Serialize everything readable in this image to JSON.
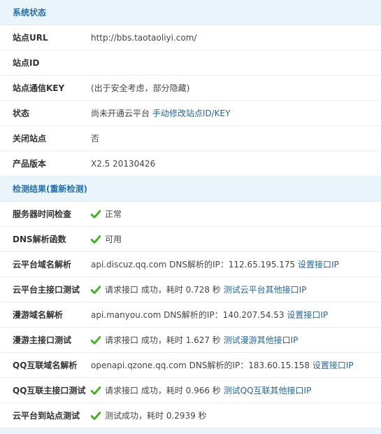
{
  "system_status": {
    "title": "系统状态",
    "rows": [
      {
        "label": "站点URL",
        "value": "http://bbs.taotaoliyi.com/"
      },
      {
        "label": "站点ID",
        "value": ""
      },
      {
        "label": "站点通信KEY",
        "value": "(出于安全考虑，部分隐藏)"
      },
      {
        "label": "状态",
        "value": "尚未开通云平台",
        "link": "手动修改站点ID/KEY"
      },
      {
        "label": "关闭站点",
        "value": "否"
      },
      {
        "label": "产品版本",
        "value": "X2.5 20130426"
      }
    ]
  },
  "check_results": {
    "title_prefix": "检测结果(",
    "recheck_link": "重新检测",
    "title_suffix": ")",
    "rows": [
      {
        "label": "服务器时间检查",
        "check": true,
        "value": "正常",
        "link": ""
      },
      {
        "label": "DNS解析函数",
        "check": true,
        "value": "可用",
        "link": ""
      },
      {
        "label": "云平台域名解析",
        "check": false,
        "value": "api.discuz.qq.com DNS解析的IP：112.65.195.175",
        "link": "设置接口IP"
      },
      {
        "label": "云平台主接口测试",
        "check": true,
        "value": "请求接口 成功，耗时 0.728 秒",
        "link": "测试云平台其他接口IP"
      },
      {
        "label": "漫游域名解析",
        "check": false,
        "value": "api.manyou.com DNS解析的IP：140.207.54.53",
        "link": "设置接口IP"
      },
      {
        "label": "漫游主接口测试",
        "check": true,
        "value": "请求接口 成功，耗时 1.627 秒",
        "link": "测试漫游其他接口IP"
      },
      {
        "label": "QQ互联域名解析",
        "check": false,
        "value": "openapi.qzone.qq.com DNS解析的IP：183.60.15.158",
        "link": "设置接口IP"
      },
      {
        "label": "QQ互联主接口测试",
        "check": true,
        "value": "请求接口 成功，耗时 0.966 秒",
        "link": "测试QQ互联其他接口IP"
      },
      {
        "label": "云平台到站点测试",
        "check": true,
        "value": "测试成功，耗时 0.2939 秒",
        "link": ""
      }
    ]
  },
  "colors": {
    "header_bg": "#eaf4fb",
    "header_text": "#2b6fa6",
    "link": "#2a6496",
    "check_green": "#4caf2a"
  },
  "icons": {
    "check": "check-icon"
  }
}
